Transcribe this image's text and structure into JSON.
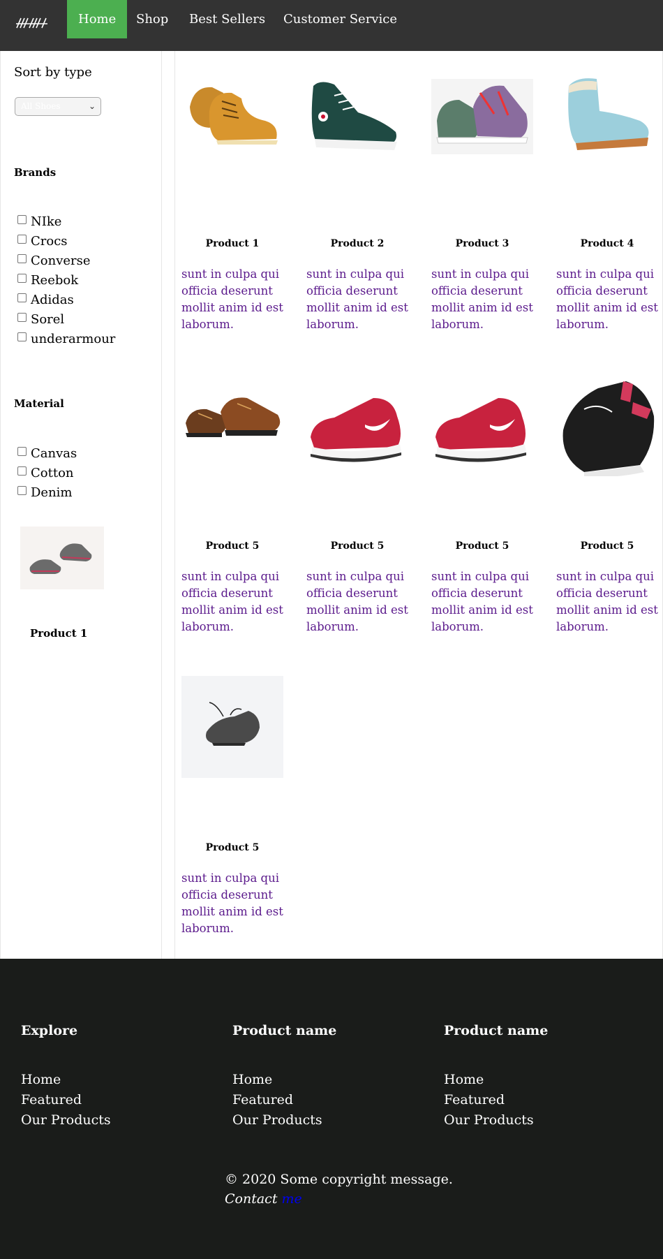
{
  "nav": {
    "logo_icon": "shoe-brand-logo",
    "items": [
      {
        "label": "Home",
        "active": true
      },
      {
        "label": "Shop",
        "active": false
      },
      {
        "label": "Best Sellers",
        "active": false
      },
      {
        "label": "Customer Service",
        "active": false
      }
    ]
  },
  "sidebar": {
    "sort_title": "Sort by type",
    "sort_select_value": "All Shoes",
    "brands_heading": "Brands",
    "brands": [
      "NIke",
      "Crocs",
      "Converse",
      "Reebok",
      "Adidas",
      "Sorel",
      "underarmour"
    ],
    "material_heading": "Material",
    "materials": [
      "Canvas",
      "Cotton",
      "Denim"
    ],
    "featured_title": "Product 1"
  },
  "products": [
    {
      "title": "Product 1",
      "desc": "sunt in culpa qui officia deserunt mollit anim id est laborum.",
      "image": "tan-work-boots"
    },
    {
      "title": "Product 2",
      "desc": "sunt in culpa qui officia deserunt mollit anim id est laborum.",
      "image": "green-hightop-sneaker"
    },
    {
      "title": "Product 3",
      "desc": "sunt in culpa qui officia deserunt mollit anim id est laborum.",
      "image": "graffiti-hightop-sneakers"
    },
    {
      "title": "Product 4",
      "desc": "sunt in culpa qui officia deserunt mollit anim id est laborum.",
      "image": "light-blue-boot"
    },
    {
      "title": "Product 5",
      "desc": "sunt in culpa qui officia deserunt mollit anim id est laborum.",
      "image": "brown-leather-shoes"
    },
    {
      "title": "Product 5",
      "desc": "sunt in culpa qui officia deserunt mollit anim id est laborum.",
      "image": "red-nike-sneaker"
    },
    {
      "title": "Product 5",
      "desc": "sunt in culpa qui officia deserunt mollit anim id est laborum.",
      "image": "red-nike-sneaker"
    },
    {
      "title": "Product 5",
      "desc": "sunt in culpa qui officia deserunt mollit anim id est laborum.",
      "image": "black-pink-sneaker"
    },
    {
      "title": "Product 5",
      "desc": "sunt in culpa qui officia deserunt mollit anim id est laborum.",
      "image": "grey-running-shoe"
    }
  ],
  "footer": {
    "columns": [
      {
        "heading": "Explore",
        "links": [
          "Home",
          "Featured",
          "Our Products"
        ]
      },
      {
        "heading": "Product name",
        "links": [
          "Home",
          "Featured",
          "Our Products"
        ]
      },
      {
        "heading": "Product name",
        "links": [
          "Home",
          "Featured",
          "Our Products"
        ]
      }
    ],
    "copyright": "© 2020 Some copyright message.",
    "contact_prefix": "Contact",
    "contact_link": "me"
  },
  "colors": {
    "nav_bg": "#333333",
    "nav_active": "#4caf50",
    "footer_bg": "#1a1c1a",
    "desc_text": "#5b1a8c",
    "link": "#0000ee"
  }
}
